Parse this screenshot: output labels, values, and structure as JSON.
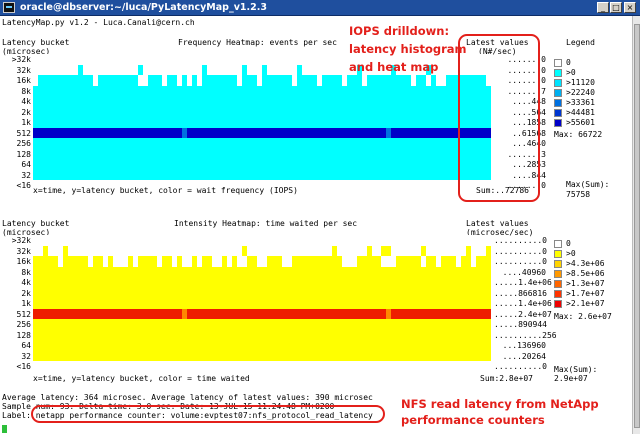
{
  "window": {
    "title": "oracle@dbserver:~/luca/PyLatencyMap_v1.2.3",
    "header_line": "LatencyMap.py v1.2 - Luca.Canali@cern.ch",
    "buttons": [
      "_",
      "□",
      "×"
    ]
  },
  "top": {
    "bucket_label": "Latency bucket",
    "unit_label": "(microsec)",
    "title": "Frequency Heatmap: events per sec",
    "latest_header": "Latest values",
    "latest_unit": "(N#/sec)",
    "legend_title": "Legend",
    "buckets": [
      ">32k",
      "32k",
      "16k",
      "8k",
      "4k",
      "2k",
      "1k",
      "512",
      "256",
      "128",
      "64",
      "32",
      "<16"
    ],
    "latest_values": [
      ".......0",
      ".......0",
      ".......0",
      ".......7",
      "....448",
      "....564",
      "...1858",
      "..61568",
      "...4640",
      ".......3",
      "...2853",
      "....844",
      ".......0"
    ],
    "legend": [
      {
        "label": "0",
        "color": "#ffffff"
      },
      {
        "label": ">0",
        "color": "#00ffff"
      },
      {
        "label": ">11120",
        "color": "#00e3ff"
      },
      {
        "label": ">22240",
        "color": "#00b0f0"
      },
      {
        "label": ">33361",
        "color": "#0070e0"
      },
      {
        "label": ">44481",
        "color": "#0036d0"
      },
      {
        "label": ">55601",
        "color": "#0000c8"
      }
    ],
    "max_label": "Max: 66722",
    "footer": "x=time, y=latency bucket, color = wait frequency (IOPS)",
    "sum_label": "Sum:..72786",
    "max_sum_label": "Max(Sum):",
    "max_sum_value": "75758",
    "row_colors": [
      "#00ffff",
      "#00ffff",
      "#00ffff",
      "#00ffff",
      "#00ffff",
      "#00ffff",
      "#00ffff",
      "#0000c8",
      "#00ffff",
      "#00ffff",
      "#00ffff",
      "#00ffff",
      "#ffffff"
    ],
    "alt_color": "#0070e0"
  },
  "bottom": {
    "bucket_label": "Latency bucket",
    "unit_label": "(microsec)",
    "title": "Intensity Heatmap: time waited per sec",
    "latest_header": "Latest values",
    "latest_unit": "(microsec/sec)",
    "buckets": [
      ">32k",
      "32k",
      "16k",
      "8k",
      "4k",
      "2k",
      "1k",
      "512",
      "256",
      "128",
      "64",
      "32",
      "<16"
    ],
    "latest_values": [
      "..........0",
      "..........0",
      "..........0",
      "....40960",
      ".....1.4e+06",
      ".....866816",
      ".....1.4e+06",
      ".....2.4e+07",
      ".....890944",
      "..........256",
      "...136960",
      "....20264",
      "..........0"
    ],
    "legend": [
      {
        "label": "0",
        "color": "#ffffff"
      },
      {
        "label": ">0",
        "color": "#ffff00"
      },
      {
        "label": ">4.3e+06",
        "color": "#ffd400"
      },
      {
        "label": ">8.5e+06",
        "color": "#ff9900"
      },
      {
        "label": ">1.3e+07",
        "color": "#ff6600"
      },
      {
        "label": ">1.7e+07",
        "color": "#ff3300"
      },
      {
        "label": ">2.1e+07",
        "color": "#ee0000"
      }
    ],
    "max_label": "Max: 2.6e+07",
    "footer": "x=time, y=latency bucket, color = time waited",
    "sum_label": "Sum:2.8e+07",
    "max_sum_label": "Max(Sum):",
    "max_sum_value": "2.9e+07",
    "row_colors": [
      "#ffffff",
      "#ffff00",
      "#ffff00",
      "#ffff00",
      "#ffff00",
      "#ffff00",
      "#ffff00",
      "#ee1c00",
      "#ffff00",
      "#ffff00",
      "#ffff00",
      "#ffff00",
      "#ffffff"
    ],
    "alt_color": "#ff8800"
  },
  "status": {
    "line1": "Average latency: 364 microsec. Average latency of latest values: 390 microsec",
    "line2": "Sample num: 93. Delta time: 3.0 sec. Date: 13-JUL-15 11.24.48 PM+0200",
    "line3": "Label: netapp performance counter: volume:evptest07:nfs_protocol_read_latency"
  },
  "annotations": {
    "iops": "IOPS drilldown:\nlatency histogram\nand heat map",
    "nfs": "NFS read latency from NetApp\nperformance counters"
  }
}
